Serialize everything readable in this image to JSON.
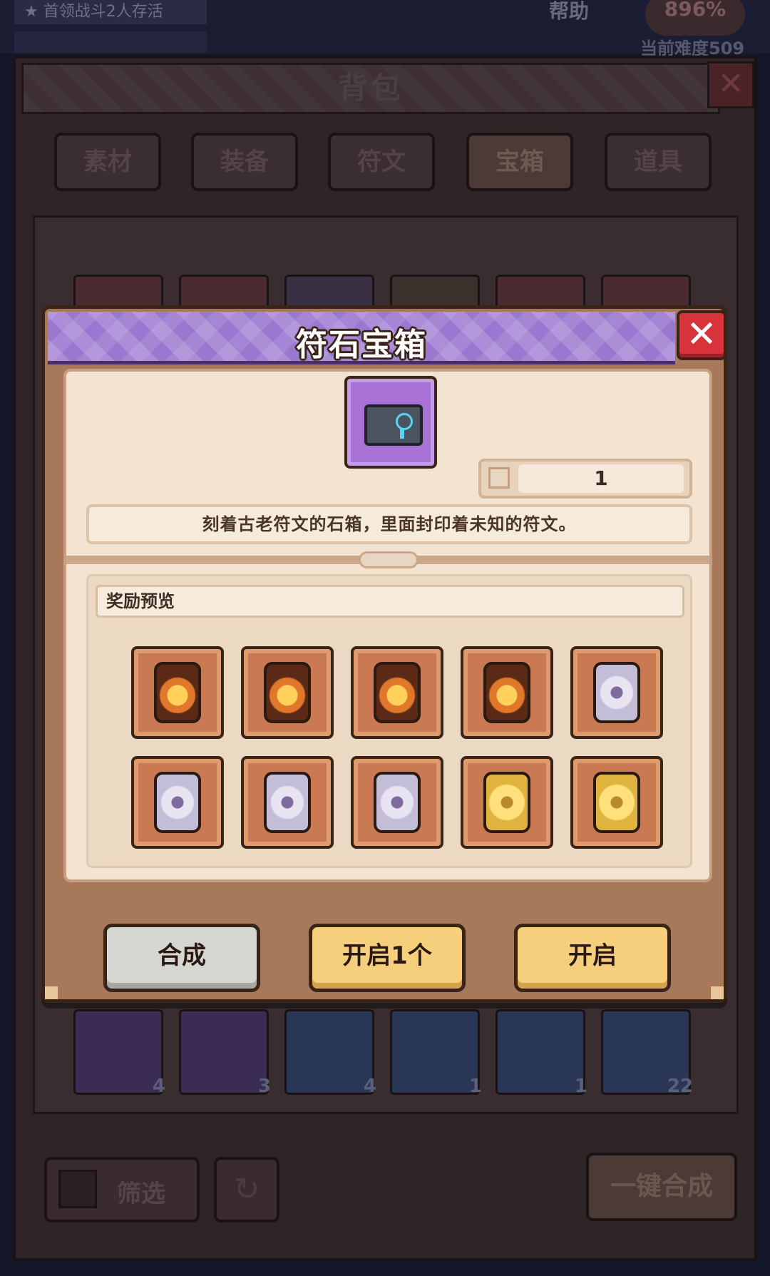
{
  "background": {
    "quest_text": "首领战斗2人存活",
    "help_label": "帮助",
    "percent": "896%",
    "difficulty": "当前难度509",
    "bag_title": "背包",
    "tabs": [
      "素材",
      "装备",
      "符文",
      "宝箱",
      "道具"
    ],
    "active_tab": "宝箱",
    "bottom_counts": [
      "4",
      "3",
      "4",
      "1",
      "1",
      "22"
    ],
    "filter_label": "筛选",
    "merge_all_label": "一键合成"
  },
  "modal": {
    "title": "符石宝箱",
    "item_icon": "rune-chest-icon",
    "count": "1",
    "description": "刻着古老符文的石箱，里面封印着未知的符文。",
    "reward_label": "奖励预览",
    "rewards": [
      {
        "icon": "fire-rune-icon"
      },
      {
        "icon": "fire-rune-icon"
      },
      {
        "icon": "fire-rune-icon"
      },
      {
        "icon": "fire-rune-icon"
      },
      {
        "icon": "silver-rune-icon"
      },
      {
        "icon": "silver-rune-icon"
      },
      {
        "icon": "silver-rune-icon"
      },
      {
        "icon": "silver-rune-icon"
      },
      {
        "icon": "gold-rune-icon"
      },
      {
        "icon": "gold-rune-icon"
      }
    ],
    "buttons": {
      "merge": "合成",
      "open_one": "开启1个",
      "open": "开启"
    },
    "colors": {
      "header": "#9b78cf",
      "close": "#d8333b",
      "gold_button": "#f6cf7d",
      "gray_button": "#d6d6d2"
    }
  }
}
